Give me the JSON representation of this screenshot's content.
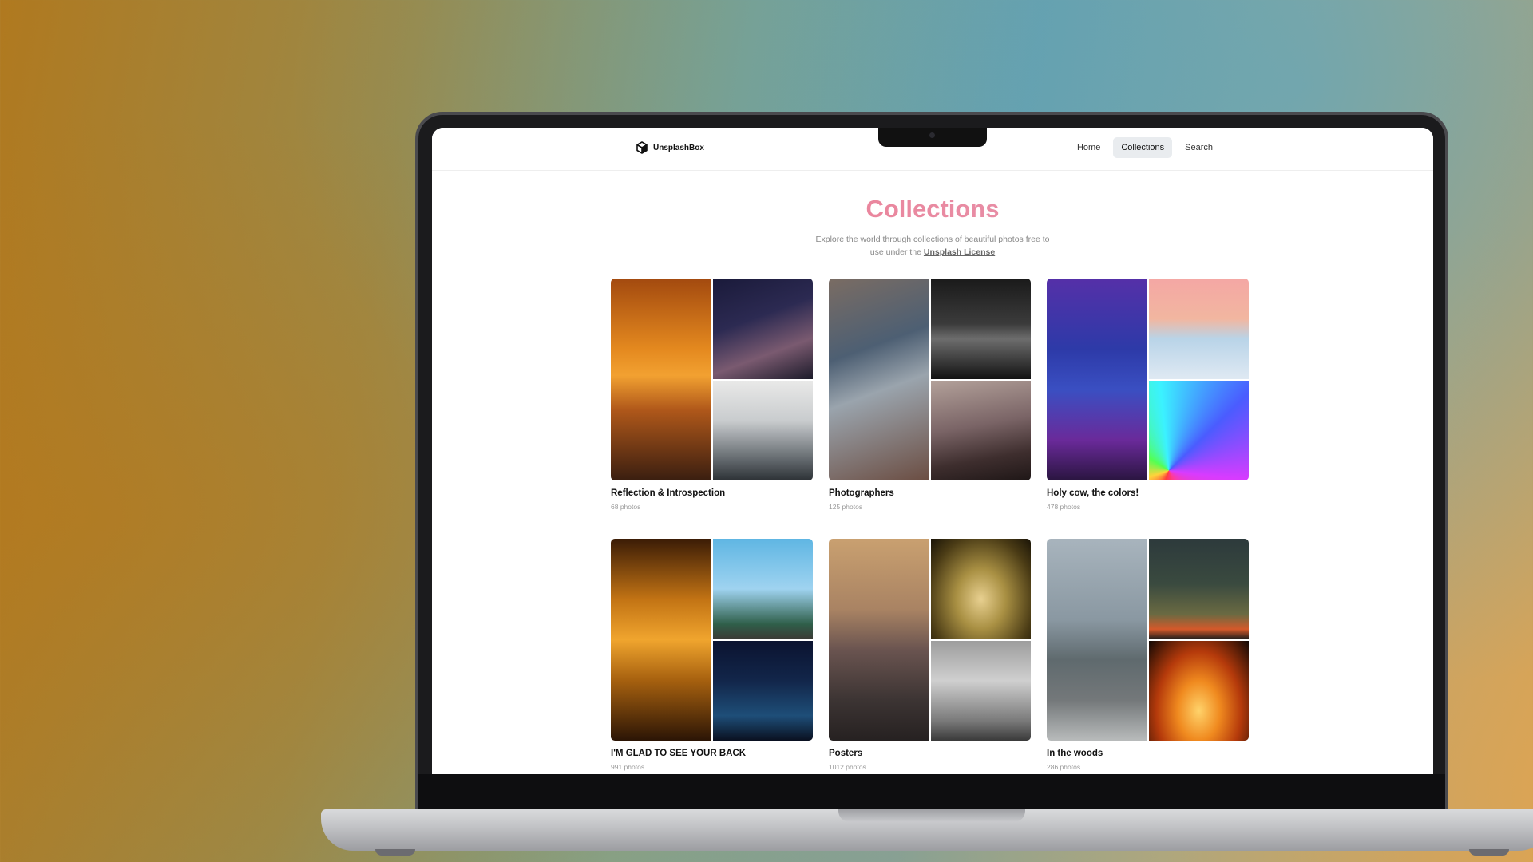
{
  "brand": {
    "name": "UnsplashBox",
    "icon": "cube-icon"
  },
  "nav": [
    {
      "label": "Home",
      "active": false
    },
    {
      "label": "Collections",
      "active": true
    },
    {
      "label": "Search",
      "active": false
    }
  ],
  "page": {
    "title": "Collections",
    "subtitle_text": "Explore the world through collections of beautiful photos free to use under the",
    "license_link": "Unsplash License"
  },
  "collections": [
    {
      "title": "Reflection & Introspection",
      "count": "68 photos",
      "images": [
        "linear-gradient(180deg,#a34a0f 0%,#e4891f 35%,#f2a131 48%,#b0581a 65%,#3a1e10 100%)",
        "linear-gradient(160deg,#1a1a3a 0%,#2c2a52 40%,#7a5a70 70%,#1c1b2a 100%)",
        "linear-gradient(180deg,#e9e9e8 0%,#c9ccce 40%,#6d7378 75%,#2d3236 100%)"
      ]
    },
    {
      "title": "Photographers",
      "count": "125 photos",
      "images": [
        "linear-gradient(160deg,#7a6c63 0%,#4d5f73 35%,#9aa4ad 55%,#6b4d42 100%)",
        "linear-gradient(180deg,#1a1a1a 0%,#3b3b3b 45%,#6d6d6d 60%,#121212 100%)",
        "linear-gradient(170deg,#b3a19a 0%,#7a6466 45%,#3e2e2e 75%,#1f1717 100%)"
      ]
    },
    {
      "title": "Holy cow, the colors!",
      "count": "478 photos",
      "images": [
        "linear-gradient(180deg,#5530a8 0%,#2d3aa8 35%,#3a4fc2 55%,#6a2a9a 80%,#2a1540 100%)",
        "linear-gradient(180deg,#f4a7a4 0%,#f2b6a0 40%,#b9d4e8 60%,#dfe9f3 100%)",
        "conic-gradient(from 200deg at 20% 90%,#ff3b3b,#ffd33b,#53ff53,#3bf2ff,#4a5cff,#d83bff,#ff3b9b,#ff3b3b)"
      ]
    },
    {
      "title": "I'M GLAD TO SEE YOUR BACK",
      "count": "991 photos",
      "images": [
        "linear-gradient(180deg,#3b1c06 0%,#c27314 30%,#f0a52e 50%,#a7610f 70%,#2b1505 100%)",
        "linear-gradient(180deg,#5fb6e3 0%,#9fd3f0 50%,#2f5f4a 85%,#3c3a35 100%)",
        "linear-gradient(180deg,#0b1330 0%,#12264a 40%,#1e4e78 75%,#0a1020 100%)"
      ]
    },
    {
      "title": "Posters",
      "count": "1012 photos",
      "images": [
        "linear-gradient(180deg,#c9a070 0%,#a98363 35%,#6a5450 55%,#3c3433 80%,#262121 100%)",
        "radial-gradient(ellipse at 50% 60%,#e8d090 0%,#a99043 35%,#4a3b15 75%,#1a1407 100%)",
        "linear-gradient(180deg,#9d9d9d 0%,#cfcfcf 40%,#7a7a7a 80%,#3a3a3a 100%)"
      ]
    },
    {
      "title": "In the woods",
      "count": "286 photos",
      "images": [
        "linear-gradient(180deg,#a8b4bd 0%,#8a98a2 40%,#5f6a6e 60%,#74787a 80%,#b8bbbb 100%)",
        "linear-gradient(180deg,#2d3a3c 0%,#3a4a3f 45%,#6a6a42 75%,#d5592a 90%,#1c1c1c 100%)",
        "radial-gradient(ellipse at 50% 70%,#ffd36b 0%,#f08a1f 30%,#b53a0b 60%,#120804 100%)"
      ]
    }
  ]
}
